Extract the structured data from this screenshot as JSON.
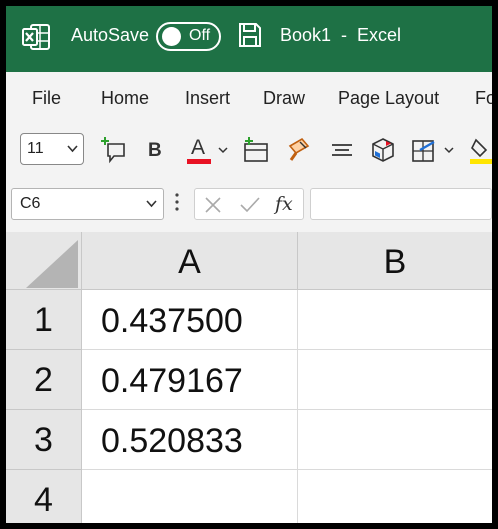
{
  "titlebar": {
    "app_icon": "excel-logo-icon",
    "autosave_label": "AutoSave",
    "autosave_state": "Off",
    "save_icon": "save-icon",
    "document_title": "Book1  -  Excel"
  },
  "menu": {
    "items": [
      {
        "label": "File"
      },
      {
        "label": "Home"
      },
      {
        "label": "Insert"
      },
      {
        "label": "Draw"
      },
      {
        "label": "Page Layout"
      },
      {
        "label": "Fo"
      }
    ]
  },
  "ribbon": {
    "font_size": "11",
    "icons": [
      "insert-comment-icon",
      "bold-icon",
      "font-color-icon",
      "insert-cells-icon",
      "format-painter-icon",
      "align-center-icon",
      "3d-models-icon",
      "borders-icon",
      "fill-color-icon"
    ],
    "bold_label": "B",
    "font_color_label": "A",
    "accent_red": "#e81123",
    "accent_yellow": "#ffe500"
  },
  "formula_bar": {
    "name_box": "C6",
    "cancel_icon": "close-icon",
    "enter_icon": "checkmark-icon",
    "function_label": "fx",
    "formula": ""
  },
  "sheet": {
    "columns": [
      "A",
      "B"
    ],
    "rows": [
      {
        "number": "1",
        "cells": [
          "0.437500",
          ""
        ]
      },
      {
        "number": "2",
        "cells": [
          "0.479167",
          ""
        ]
      },
      {
        "number": "3",
        "cells": [
          "0.520833",
          ""
        ]
      },
      {
        "number": "4",
        "cells": [
          "",
          ""
        ]
      }
    ]
  },
  "colors": {
    "titlebar": "#1e7145",
    "ribbon_bg": "#f3f3f3",
    "header_bg": "#e6e6e6"
  }
}
